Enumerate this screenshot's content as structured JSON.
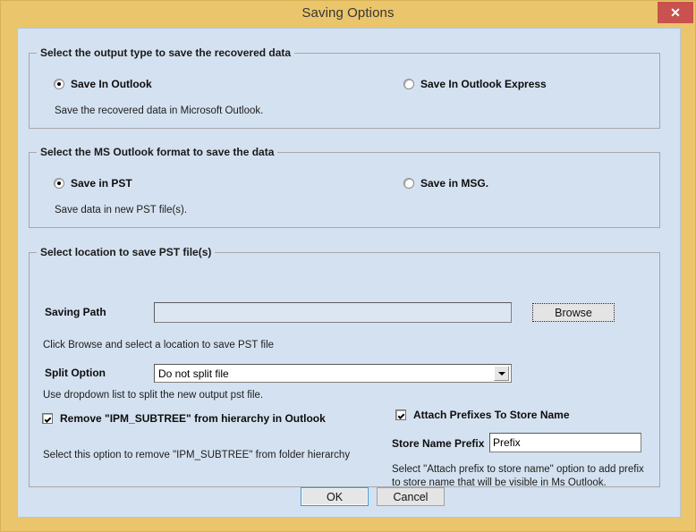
{
  "window": {
    "title": "Saving Options",
    "close_label": "✕"
  },
  "colors": {
    "title_bar": "#eac56b",
    "close_button": "#c9524f",
    "dialog_body": "#d4e1f0",
    "focus_border": "#3c9ade"
  },
  "group_output": {
    "legend": "Select the output type to save the recovered data",
    "options": [
      {
        "label": "Save In Outlook",
        "checked": true
      },
      {
        "label": "Save In Outlook Express",
        "checked": false
      }
    ],
    "hint": "Save the recovered data in Microsoft Outlook."
  },
  "group_format": {
    "legend": "Select the MS Outlook format to save the data",
    "options": [
      {
        "label": "Save in PST",
        "checked": true
      },
      {
        "label": "Save in MSG.",
        "checked": false
      }
    ],
    "hint": "Save data in new PST file(s)."
  },
  "group_location": {
    "legend": "Select location to save PST file(s)",
    "saving_path": {
      "label": "Saving Path",
      "value": "",
      "placeholder": ""
    },
    "browse_button": "Browse",
    "browse_hint": "Click Browse and select a location to save PST file",
    "split_option": {
      "label": "Split Option",
      "value": "Do not split file",
      "options": [
        "Do not split file"
      ],
      "hint": "Use dropdown list to split the new output pst file."
    },
    "remove_subtree": {
      "label": "Remove \"IPM_SUBTREE\" from hierarchy in Outlook",
      "checked": true,
      "hint": "Select this option to remove \"IPM_SUBTREE\" from folder hierarchy"
    },
    "attach_prefixes": {
      "label": "Attach Prefixes To Store Name",
      "checked": true,
      "prefix_label": "Store Name Prefix",
      "prefix_value": "Prefix",
      "hint": "Select \"Attach prefix to store name\" option to add prefix to store name that will be visible in Ms Outlook."
    }
  },
  "footer": {
    "ok_label": "OK",
    "cancel_label": "Cancel"
  }
}
